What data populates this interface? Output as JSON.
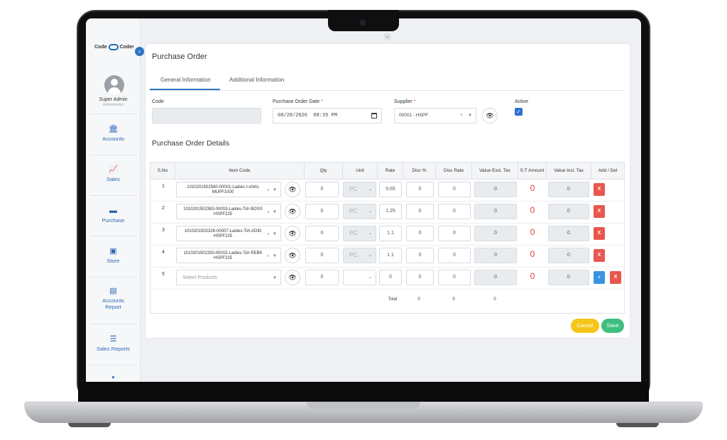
{
  "brand": {
    "logo_left": "Code",
    "logo_right": "Coder"
  },
  "user": {
    "name": "Super Admin",
    "role": "Administrator"
  },
  "sidebar": {
    "items": [
      {
        "label": "Accounts",
        "icon": "bank-icon"
      },
      {
        "label": "Sales",
        "icon": "trend-chart-icon"
      },
      {
        "label": "Purchase",
        "icon": "card-icon"
      },
      {
        "label": "Store",
        "icon": "store-box-icon"
      },
      {
        "label": "Accounts Report",
        "icon": "report-document-icon"
      },
      {
        "label": "Sales Reports",
        "icon": "list-icon"
      }
    ]
  },
  "page": {
    "title": "Purchase Order"
  },
  "tabs": [
    {
      "label": "General Information",
      "active": true
    },
    {
      "label": "Additional Information",
      "active": false
    }
  ],
  "form": {
    "code_label": "Code",
    "code_value": "",
    "date_label": "Purchase Order Date",
    "date_value": "08/28/2026  08:35 PM",
    "supplier_label": "Supplier",
    "supplier_value": "00001 - HSPF",
    "active_label": "Active",
    "active_checked": true,
    "required_mark": "*"
  },
  "details": {
    "section_title": "Purchase Order Details",
    "columns": [
      "S.No",
      "Item Code",
      "Qty",
      "Unit",
      "Rate",
      "Disc %",
      "Disc Rate",
      "Value Excl. Tax",
      "S.T Amount",
      "Value Incl. Tax",
      "Add / Del"
    ],
    "rows": [
      {
        "sno": "1",
        "item": "1010201502580-00001-Ladies t-shirts MUPF1000",
        "qty": "0",
        "unit": "PC",
        "rate": "0.65",
        "disc_pct": "0",
        "disc_rate": "0",
        "value_excl": "0",
        "st_amount": "0",
        "value_incl": "0"
      },
      {
        "sno": "2",
        "item": "1010201502383-00003-Ladies-Tsh BOSS HSPF225",
        "qty": "0",
        "unit": "PC",
        "rate": "1.25",
        "disc_pct": "0",
        "disc_rate": "0",
        "value_excl": "0",
        "st_amount": "0",
        "value_incl": "0"
      },
      {
        "sno": "3",
        "item": "1010201502326-00007-Ladies-Tsh ADID HSPF225",
        "qty": "0",
        "unit": "PC",
        "rate": "1.1",
        "disc_pct": "0",
        "disc_rate": "0",
        "value_excl": "0",
        "st_amount": "0",
        "value_incl": "0"
      },
      {
        "sno": "4",
        "item": "1010201502330-00015-Ladies-Tsh REBK HSPF225",
        "qty": "0",
        "unit": "PC",
        "rate": "1.1",
        "disc_pct": "0",
        "disc_rate": "0",
        "value_excl": "0",
        "st_amount": "0",
        "value_incl": "0"
      },
      {
        "sno": "5",
        "item_placeholder": "Select Products",
        "qty": "0",
        "unit": "",
        "rate": "0",
        "disc_pct": "0",
        "disc_rate": "0",
        "value_excl": "0",
        "st_amount": "0",
        "value_incl": "0"
      }
    ],
    "totals": {
      "label": "Total",
      "disc_pct": "0",
      "disc_rate": "0",
      "value_excl": "0"
    },
    "del_label": "X",
    "add_label": "+"
  },
  "actions": {
    "cancel_label": "Cancel",
    "save_label": "Save"
  },
  "colors": {
    "primary": "#2d74c4",
    "danger": "#e8574f",
    "warning": "#f5c518",
    "success": "#3fbf7f"
  }
}
